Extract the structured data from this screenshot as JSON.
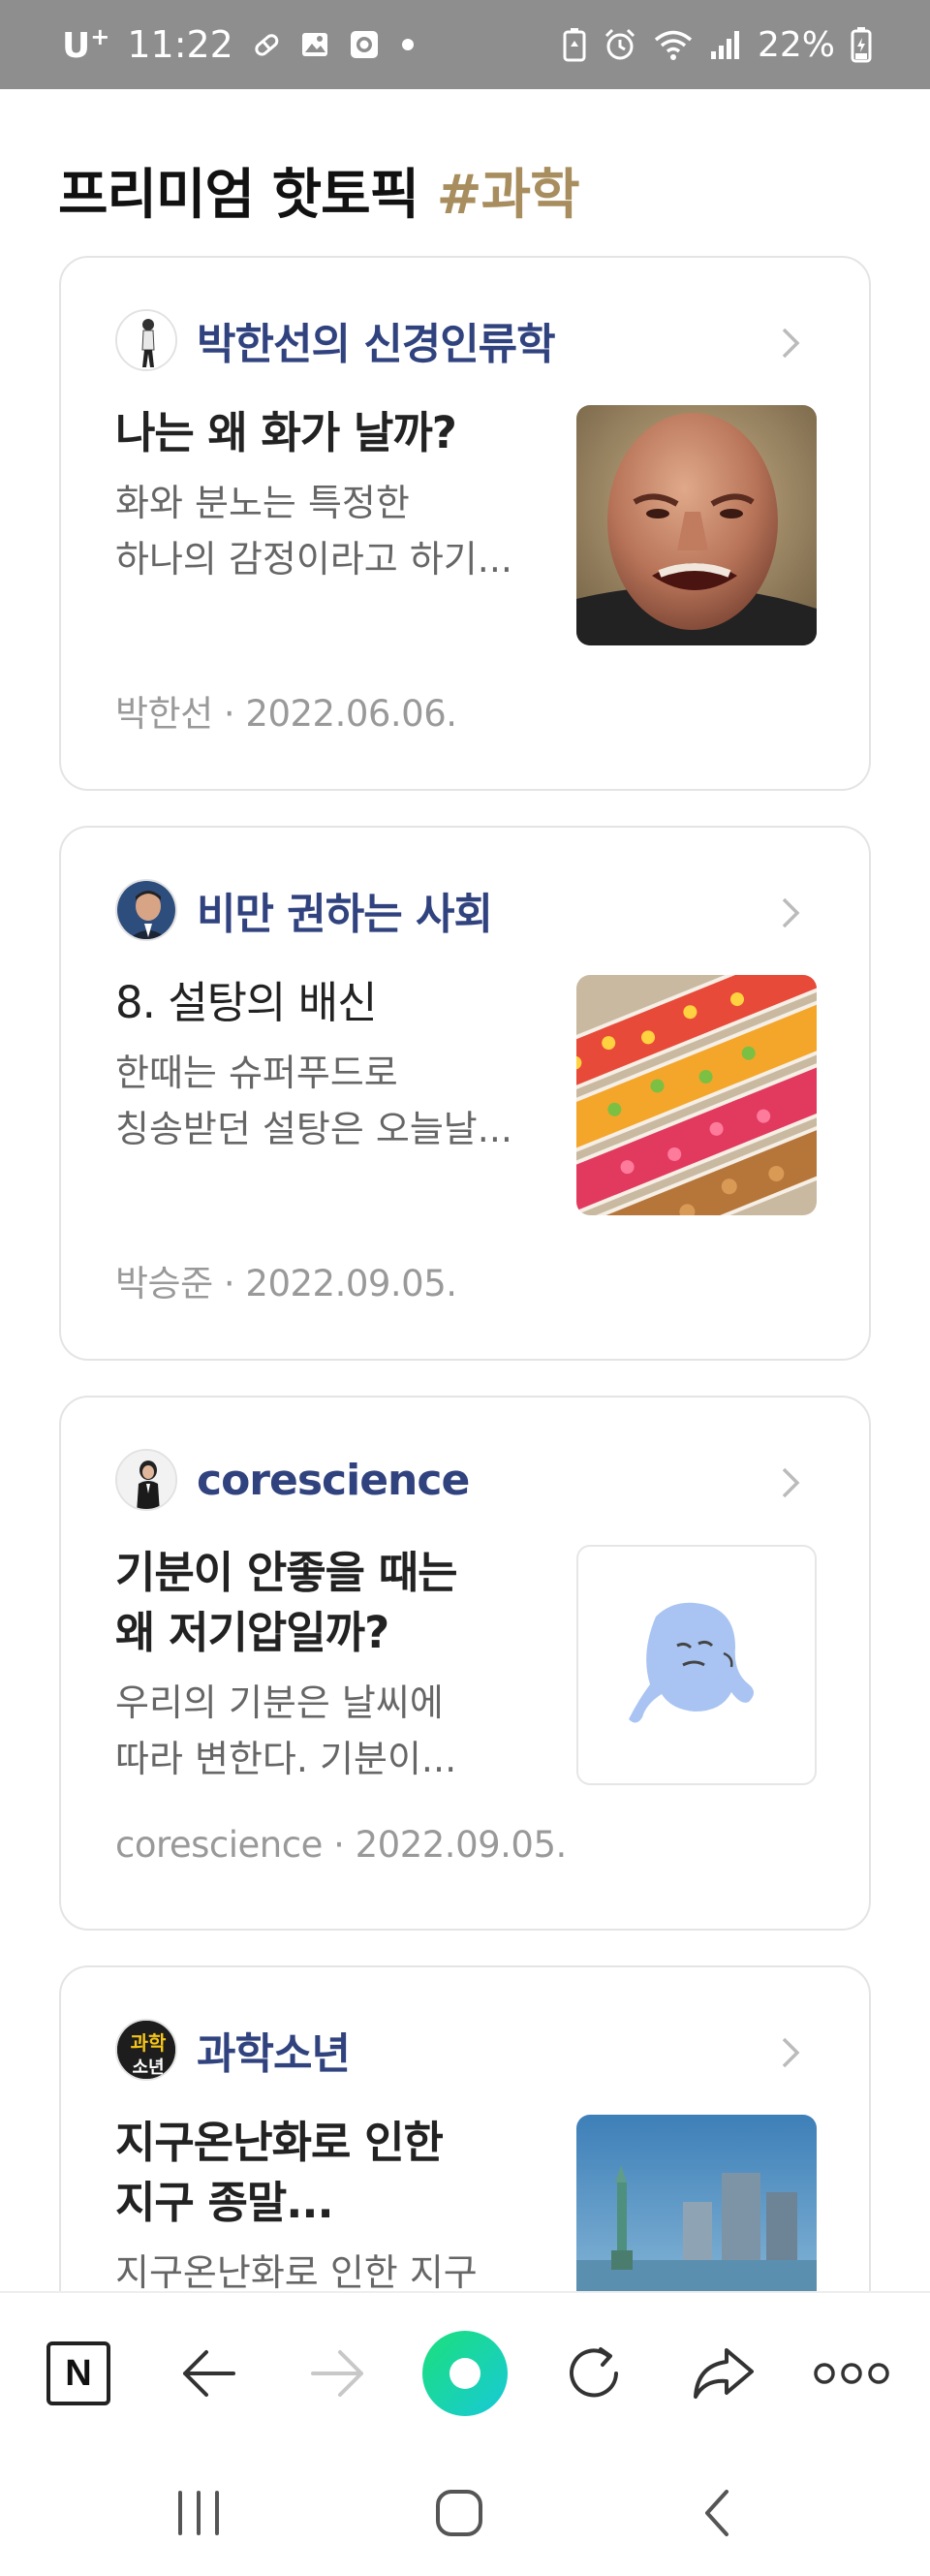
{
  "status_bar": {
    "carrier": "U",
    "carrier_sup": "+",
    "time": "11:22",
    "battery": "22%"
  },
  "header": {
    "title": "프리미엄 핫토픽",
    "tag": "#과학"
  },
  "cards": [
    {
      "source": "박한선의 신경인류학",
      "title": "나는 왜 화가 날까?",
      "desc_line1": "화와 분노는 특정한",
      "desc_line2": "하나의 감정이라고 하기...",
      "meta": "박한선 · 2022.06.06."
    },
    {
      "source": "비만 권하는 사회",
      "title": "8. 설탕의 배신",
      "desc_line1": "한때는 슈퍼푸드로",
      "desc_line2": "칭송받던 설탕은 오늘날...",
      "meta": "박승준 · 2022.09.05."
    },
    {
      "source": "corescience",
      "title_line1": "기분이 안좋을 때는",
      "title_line2": "왜 저기압일까?",
      "desc_line1": "우리의 기분은 날씨에",
      "desc_line2": "따라 변한다. 기분이...",
      "meta": "corescience · 2022.09.05."
    },
    {
      "source": "과학소년",
      "avatar_text_1": "과학",
      "avatar_text_2": "소년",
      "title_line1": "지구온난화로 인한",
      "title_line2": "지구 종말...",
      "desc_line1": "지구온난화로 인한 지구"
    }
  ],
  "toolbar": {
    "home_label": "N"
  },
  "colors": {
    "accent_tag": "#a88e5e",
    "source_blue": "#31437f",
    "green_button": "#1ed9a0"
  }
}
